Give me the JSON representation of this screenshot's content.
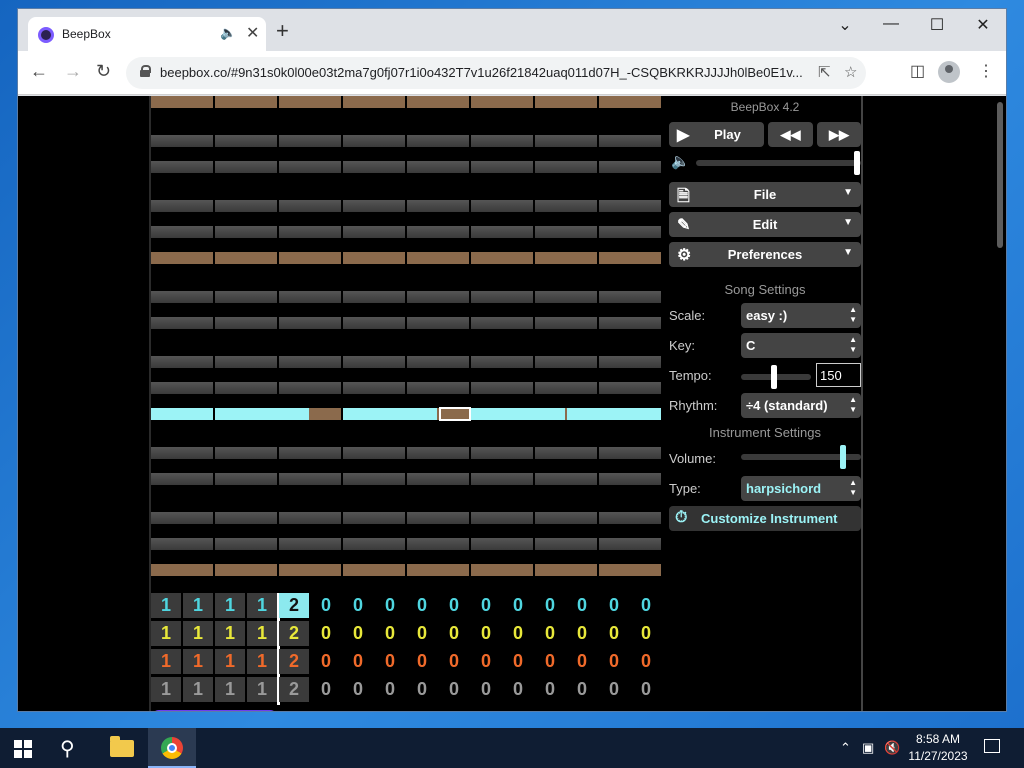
{
  "browser": {
    "tab_title": "BeepBox",
    "tab_audio_icon": "speaker-icon",
    "url": "beepbox.co/#9n31s0k0l00e03t2ma7g0fj07r1i0o432T7v1u26f21842uaq011d07H_-CSQBKRKRJJJJh0lBe0E1v..."
  },
  "app": {
    "title": "BeepBox 4.2",
    "play_label": "Play",
    "file_label": "File",
    "edit_label": "Edit",
    "preferences_label": "Preferences",
    "song_settings_label": "Song Settings",
    "scale_label": "Scale:",
    "scale_value": "easy :)",
    "key_label": "Key:",
    "key_value": "C",
    "tempo_label": "Tempo:",
    "tempo_value": "150",
    "rhythm_label": "Rhythm:",
    "rhythm_value": "÷4 (standard)",
    "instrument_settings_label": "Instrument Settings",
    "volume_label": "Volume:",
    "type_label": "Type:",
    "type_value": "harpsichord",
    "customize_label": "Customize Instrument",
    "accent_color": "#9cf3f6",
    "song_volume_level": 1.0,
    "tempo_slider_level": 0.5,
    "instrument_volume_level": 0.82
  },
  "pattern_grid": {
    "rows": [
      {
        "color": "#4fd6e0",
        "values": [
          "1",
          "1",
          "1",
          "1",
          "2",
          "0",
          "0",
          "0",
          "0",
          "0",
          "0",
          "0",
          "0",
          "0",
          "0",
          "0"
        ]
      },
      {
        "color": "#e8e83a",
        "values": [
          "1",
          "1",
          "1",
          "1",
          "2",
          "0",
          "0",
          "0",
          "0",
          "0",
          "0",
          "0",
          "0",
          "0",
          "0",
          "0"
        ]
      },
      {
        "color": "#f06a2a",
        "values": [
          "1",
          "1",
          "1",
          "1",
          "2",
          "0",
          "0",
          "0",
          "0",
          "0",
          "0",
          "0",
          "0",
          "0",
          "0",
          "0"
        ]
      },
      {
        "color": "#9a9a9a",
        "values": [
          "1",
          "1",
          "1",
          "1",
          "2",
          "0",
          "0",
          "0",
          "0",
          "0",
          "0",
          "0",
          "0",
          "0",
          "0",
          "0"
        ]
      }
    ],
    "selected_row": 0,
    "selected_col": 4
  },
  "taskbar": {
    "time": "8:58 AM",
    "date": "11/27/2023"
  }
}
